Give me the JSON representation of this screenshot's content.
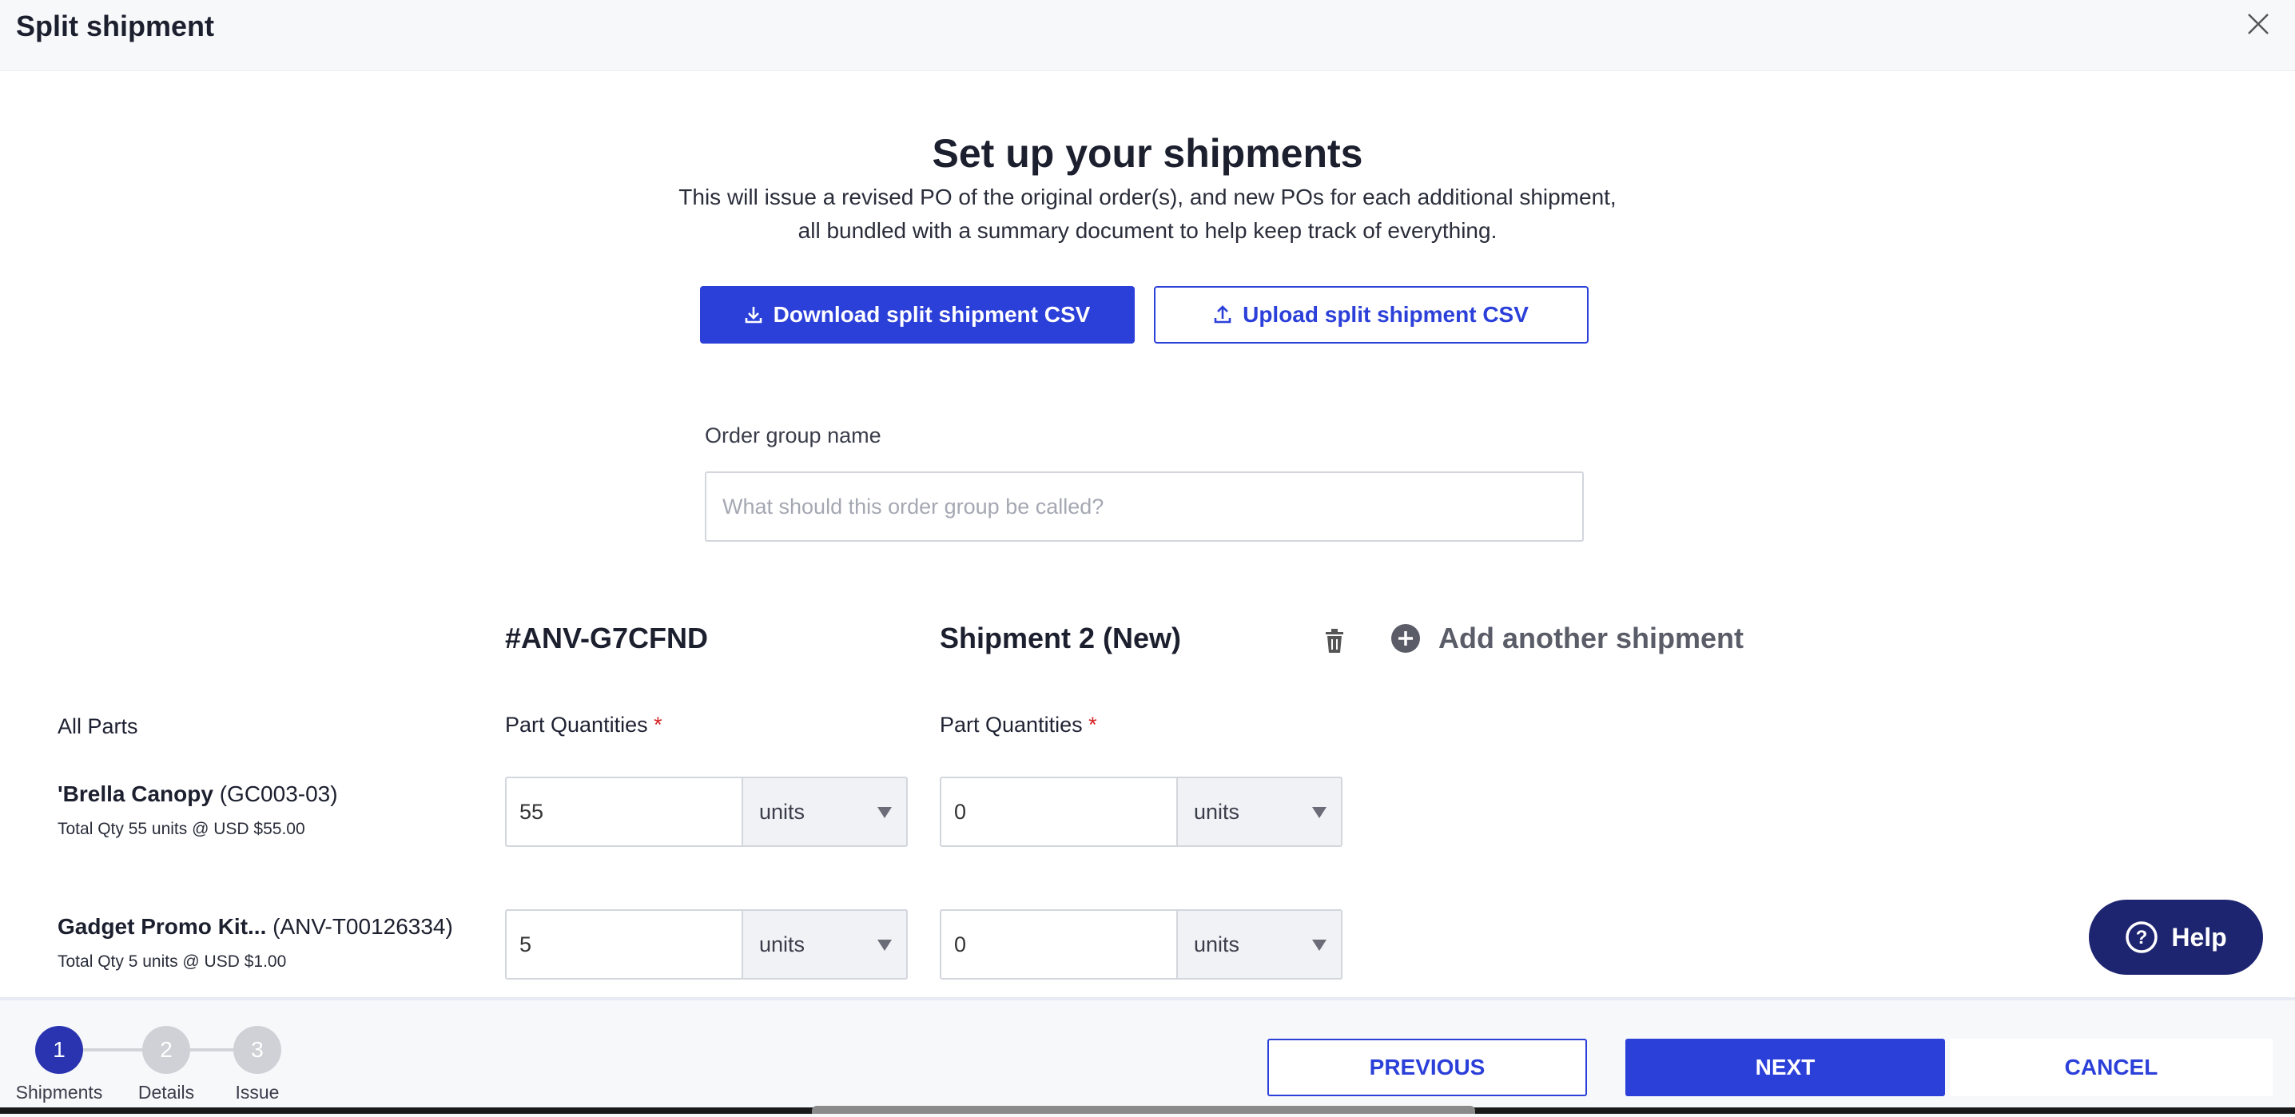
{
  "header": {
    "title": "Split shipment"
  },
  "main": {
    "title": "Set up your shipments",
    "description_line1": "This will issue a revised PO of the original order(s), and new POs for each additional shipment,",
    "description_line2": "all bundled with a summary document to help keep track of everything.",
    "download_label": "Download split shipment CSV",
    "upload_label": "Upload split shipment CSV"
  },
  "order_group": {
    "label": "Order group name",
    "placeholder": "What should this order group be called?",
    "value": ""
  },
  "columns": {
    "original": "#ANV-G7CFND",
    "shipment2": "Shipment 2 (New)",
    "add_label": "Add another shipment"
  },
  "table": {
    "all_parts_label": "All Parts",
    "qty_label": "Part Quantities",
    "required_mark": "*",
    "rows": [
      {
        "name": "'Brella Canopy",
        "code": "(GC003-03)",
        "summary": "Total Qty 55 units @ USD $55.00",
        "original_qty": "55",
        "original_unit": "units",
        "new_qty": "0",
        "new_unit": "units"
      },
      {
        "name": "Gadget Promo Kit...",
        "code": "(ANV-T00126334)",
        "summary": "Total Qty 5 units @ USD $1.00",
        "original_qty": "5",
        "original_unit": "units",
        "new_qty": "0",
        "new_unit": "units"
      }
    ]
  },
  "help": {
    "label": "Help"
  },
  "footer": {
    "steps": [
      {
        "number": "1",
        "label": "Shipments"
      },
      {
        "number": "2",
        "label": "Details"
      },
      {
        "number": "3",
        "label": "Issue"
      }
    ],
    "previous_label": "PREVIOUS",
    "next_label": "NEXT",
    "cancel_label": "CANCEL"
  },
  "colors": {
    "primary": "#2b3fd9",
    "step_active": "#2a34b0",
    "step_inactive": "#cfd1d6",
    "help_bg": "#1d2470",
    "required": "#d62020"
  },
  "icons": [
    "close-icon",
    "download-icon",
    "upload-icon",
    "trash-icon",
    "plus-circle-icon",
    "help-icon",
    "chevron-down-icon"
  ]
}
